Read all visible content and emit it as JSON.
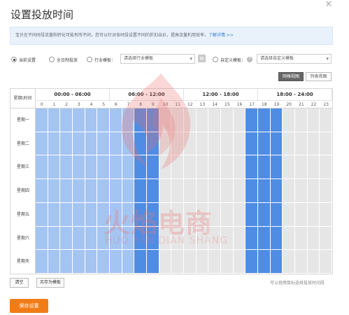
{
  "dialog": {
    "title": "设置投放时间",
    "close_icon": "close-icon"
  },
  "notice": {
    "text": "宝贝在不同时段流量和转化可能有所不同，您可以针对各时段设置不同的折扣出价，提高流量利用效率，",
    "link": "了解详情 >>"
  },
  "options": {
    "current": "当前设置",
    "all_day": "全日制投放",
    "industry": "行业模板：",
    "industry_select": "请选择行业模板",
    "custom": "自定义模板：",
    "custom_select": "请选择自定义模板",
    "help": "?",
    "selected": "current"
  },
  "view_toggle": {
    "grid": "网格视图",
    "list": "列表视图",
    "active": "grid"
  },
  "grid": {
    "corner_label": "星期\\时间",
    "ranges": [
      "00:00 - 06:00",
      "06:00 - 12:00",
      "12:00 - 18:00",
      "18:00 - 24:00"
    ],
    "hours": [
      "0",
      "1",
      "2",
      "3",
      "4",
      "5",
      "6",
      "7",
      "8",
      "9",
      "10",
      "11",
      "12",
      "13",
      "14",
      "15",
      "16",
      "17",
      "18",
      "19",
      "20",
      "21",
      "22",
      "23"
    ],
    "days": [
      "星期一",
      "星期二",
      "星期三",
      "星期四",
      "星期五",
      "星期六",
      "星期天"
    ],
    "hour_states": [
      "light",
      "light",
      "light",
      "light",
      "light",
      "light",
      "light",
      "light",
      "dark",
      "dark",
      "off",
      "off",
      "off",
      "off",
      "off",
      "off",
      "off",
      "dark",
      "dark",
      "dark",
      "off",
      "off",
      "off",
      "off"
    ],
    "colors": {
      "off": "#e6e6e6",
      "light": "#a4c4f2",
      "dark": "#4f8de4"
    }
  },
  "watermark": {
    "text": "火焰电商",
    "sub": "HUO YAN DIAN SHANG"
  },
  "footer": {
    "clear": "清空",
    "save_template": "另存为模板",
    "hint": "可以拖拽鼠标选择投放时间段",
    "save": "保存设置"
  }
}
